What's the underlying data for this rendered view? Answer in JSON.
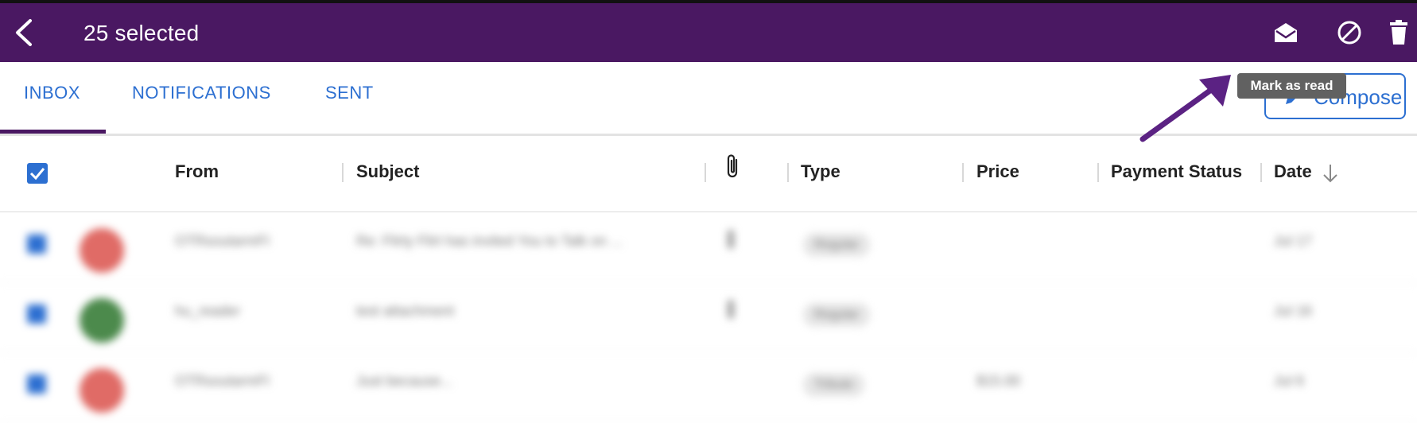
{
  "appbar": {
    "selected_text": "25 selected",
    "background": "#4a1862",
    "actions": [
      {
        "icon": "mail-open-icon",
        "label": "Mark as read"
      },
      {
        "icon": "block-icon",
        "label": "Block"
      },
      {
        "icon": "trash-icon",
        "label": "Delete"
      }
    ]
  },
  "tabs": [
    {
      "label": "INBOX",
      "active": true
    },
    {
      "label": "NOTIFICATIONS",
      "active": false
    },
    {
      "label": "SENT",
      "active": false
    }
  ],
  "compose": {
    "label": "Compose"
  },
  "tooltip": {
    "text": "Mark as read"
  },
  "table": {
    "select_all_checked": true,
    "columns": [
      "From",
      "Subject",
      "",
      "Type",
      "Price",
      "Payment Status",
      "Date"
    ],
    "attachment_icon": "paperclip-icon",
    "sort_icon": "arrow-down-icon",
    "rows": [
      {
        "from": "OTRsoutarmFI",
        "subject": "Re: Flirty Flirt has invited You to Talk on ...",
        "attachment": true,
        "type": "Regular",
        "price": "",
        "payment_status": "",
        "date": "Jul 17",
        "avatar_color": "#e06b66"
      },
      {
        "from": "hu_reader",
        "subject": "test attachment",
        "attachment": true,
        "type": "Regular",
        "price": "",
        "payment_status": "",
        "date": "Jul 16",
        "avatar_color": "#4c8a4c"
      },
      {
        "from": "OTRsoutarmFI",
        "subject": "Just because...",
        "attachment": false,
        "type": "Tribute",
        "price": "$15.00",
        "payment_status": "",
        "date": "Jul 6",
        "avatar_color": "#e06b66"
      }
    ]
  },
  "colors": {
    "accent": "#2c6fd1",
    "tooltip": "#616161",
    "arrow": "#5b2283"
  }
}
